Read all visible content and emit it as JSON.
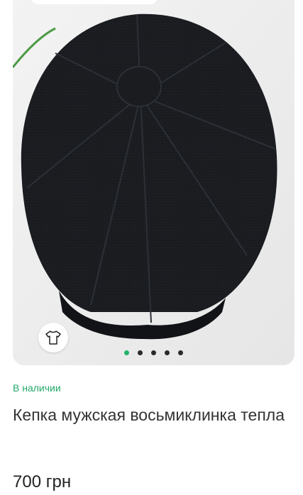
{
  "product": {
    "availability": "В наличии",
    "title": "Кепка мужская восьмиклинка тепла",
    "price": "700 грн"
  },
  "gallery": {
    "image_count": 5,
    "active_index": 0
  },
  "colors": {
    "accent": "#23b26d",
    "text": "#333333"
  },
  "icons": {
    "try_on": "tshirt-icon"
  }
}
